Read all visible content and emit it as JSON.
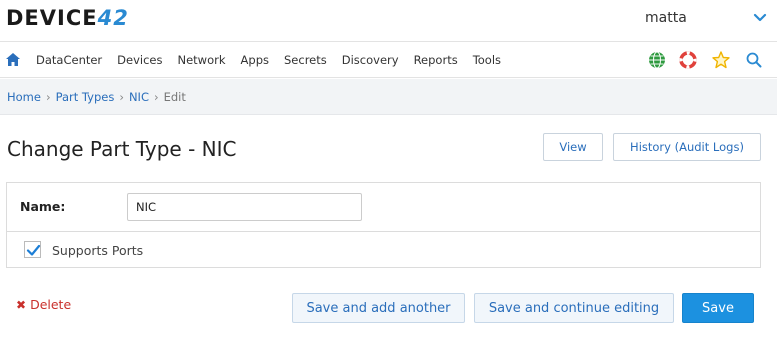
{
  "header": {
    "logo_text": "DEVICE",
    "logo_number": "42",
    "username": "matta"
  },
  "nav": {
    "items": [
      "DataCenter",
      "Devices",
      "Network",
      "Apps",
      "Secrets",
      "Discovery",
      "Reports",
      "Tools"
    ],
    "icons": [
      "globe-icon",
      "lifebuoy-icon",
      "star-icon",
      "search-icon"
    ]
  },
  "breadcrumb": {
    "home": "Home",
    "part_types": "Part Types",
    "nic": "NIC",
    "current": "Edit"
  },
  "page": {
    "title": "Change Part Type - NIC",
    "view_label": "View",
    "history_label": "History (Audit Logs)"
  },
  "form": {
    "name_label": "Name:",
    "name_value": "NIC",
    "supports_ports_label": "Supports Ports",
    "supports_ports_checked": true
  },
  "actions": {
    "delete_label": "Delete",
    "save_add_another_label": "Save and add another",
    "save_continue_label": "Save and continue editing",
    "save_label": "Save"
  },
  "colors": {
    "accent": "#2a8ad2",
    "link": "#2a6ebb",
    "primary_button": "#1c91e0",
    "danger": "#c9302c"
  }
}
